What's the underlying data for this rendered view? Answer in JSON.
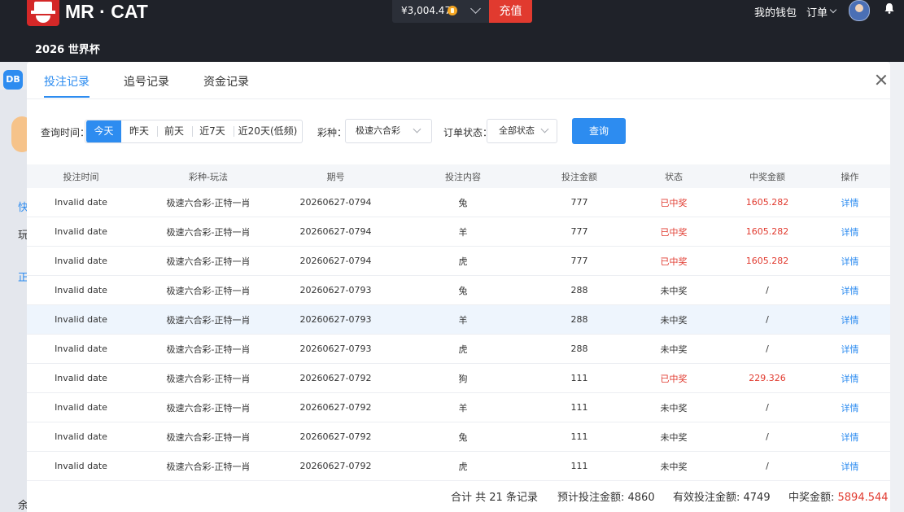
{
  "header": {
    "brand": "MR · CAT",
    "balance": "¥3,004.47",
    "recharge": "充值",
    "nav_wallet": "我的钱包",
    "nav_orders": "订单",
    "subnav": "2026 世界杯"
  },
  "background": {
    "db_badge": "DB",
    "side_chars": [
      "快",
      "玩",
      "正",
      "余"
    ]
  },
  "modal": {
    "tabs": [
      "投注记录",
      "追号记录",
      "资金记录"
    ],
    "active_tab": 0
  },
  "filters": {
    "time_label": "查询时间：",
    "time_options": [
      "今天",
      "昨天",
      "前天",
      "近7天",
      "近20天(低频)"
    ],
    "lottery_label": "彩种：",
    "lottery_value": "极速六合彩",
    "status_label": "订单状态：",
    "status_value": "全部状态",
    "query_button": "查询"
  },
  "table": {
    "headers": [
      "投注时间",
      "彩种-玩法",
      "期号",
      "投注内容",
      "投注金额",
      "状态",
      "中奖金额",
      "操作"
    ],
    "rows": [
      [
        "Invalid date",
        "极速六合彩-正特一肖",
        "20260627-0794",
        "兔",
        "777",
        "已中奖",
        "1605.282",
        "详情"
      ],
      [
        "Invalid date",
        "极速六合彩-正特一肖",
        "20260627-0794",
        "羊",
        "777",
        "已中奖",
        "1605.282",
        "详情"
      ],
      [
        "Invalid date",
        "极速六合彩-正特一肖",
        "20260627-0794",
        "虎",
        "777",
        "已中奖",
        "1605.282",
        "详情"
      ],
      [
        "Invalid date",
        "极速六合彩-正特一肖",
        "20260627-0793",
        "兔",
        "288",
        "未中奖",
        "/",
        "详情"
      ],
      [
        "Invalid date",
        "极速六合彩-正特一肖",
        "20260627-0793",
        "羊",
        "288",
        "未中奖",
        "/",
        "详情"
      ],
      [
        "Invalid date",
        "极速六合彩-正特一肖",
        "20260627-0793",
        "虎",
        "288",
        "未中奖",
        "/",
        "详情"
      ],
      [
        "Invalid date",
        "极速六合彩-正特一肖",
        "20260627-0792",
        "狗",
        "111",
        "已中奖",
        "229.326",
        "详情"
      ],
      [
        "Invalid date",
        "极速六合彩-正特一肖",
        "20260627-0792",
        "羊",
        "111",
        "未中奖",
        "/",
        "详情"
      ],
      [
        "Invalid date",
        "极速六合彩-正特一肖",
        "20260627-0792",
        "兔",
        "111",
        "未中奖",
        "/",
        "详情"
      ],
      [
        "Invalid date",
        "极速六合彩-正特一肖",
        "20260627-0792",
        "虎",
        "111",
        "未中奖",
        "/",
        "详情"
      ]
    ]
  },
  "summary": {
    "total_records": "合计 共 21 条记录",
    "expected_label": "预计投注金额: 4860",
    "valid_label": "有效投注金额: 4749",
    "win_label": "中奖金额: ",
    "win_value": "5894.544"
  },
  "colors": {
    "accent": "#2d8cf0",
    "win": "#e13a2f",
    "header_bg": "#1f2229"
  }
}
